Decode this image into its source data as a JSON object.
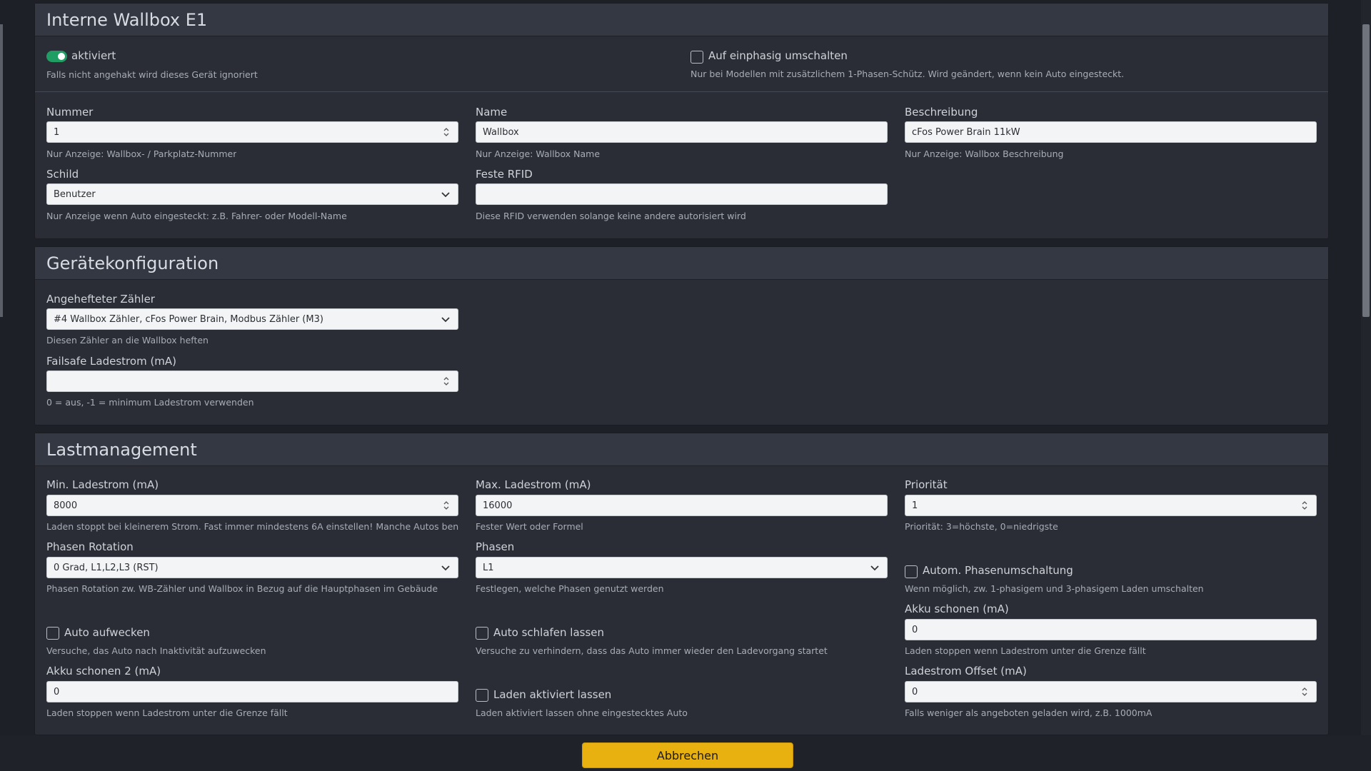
{
  "wallbox_section": {
    "title": "Interne Wallbox E1",
    "activated_label": "aktiviert",
    "activated_help": "Falls nicht angehakt wird dieses Gerät ignoriert",
    "single_phase_label": "Auf einphasig umschalten",
    "single_phase_help": "Nur bei Modellen mit zusätzlichem 1-Phasen-Schütz. Wird geändert, wenn kein Auto eingesteckt.",
    "number": {
      "label": "Nummer",
      "value": "1",
      "help": "Nur Anzeige: Wallbox- / Parkplatz-Nummer"
    },
    "name": {
      "label": "Name",
      "value": "Wallbox",
      "help": "Nur Anzeige: Wallbox Name"
    },
    "description": {
      "label": "Beschreibung",
      "value": "cFos Power Brain 11kW",
      "help": "Nur Anzeige: Wallbox Beschreibung"
    },
    "sign": {
      "label": "Schild",
      "value": "Benutzer",
      "help": "Nur Anzeige wenn Auto eingesteckt: z.B. Fahrer- oder Modell-Name"
    },
    "rfid": {
      "label": "Feste RFID",
      "value": "",
      "help": "Diese RFID verwenden solange keine andere autorisiert wird"
    }
  },
  "device_config": {
    "title": "Gerätekonfiguration",
    "meter": {
      "label": "Angehefteter Zähler",
      "value": "#4 Wallbox Zähler, cFos Power Brain, Modbus Zähler (M3)",
      "help": "Diesen Zähler an die Wallbox heften"
    },
    "failsafe": {
      "label": "Failsafe Ladestrom (mA)",
      "value": "",
      "help": "0 = aus, -1 = minimum Ladestrom verwenden"
    }
  },
  "load_management": {
    "title": "Lastmanagement",
    "min_current": {
      "label": "Min. Ladestrom (mA)",
      "value": "8000",
      "help": "Laden stoppt bei kleinerem Strom. Fast immer mindestens 6A einstellen! Manche Autos benötige..."
    },
    "max_current": {
      "label": "Max. Ladestrom (mA)",
      "value": "16000",
      "help": "Fester Wert oder Formel"
    },
    "priority": {
      "label": "Priorität",
      "value": "1",
      "help": "Priorität: 3=höchste, 0=niedrigste"
    },
    "phase_rotation": {
      "label": "Phasen Rotation",
      "value": "0 Grad, L1,L2,L3 (RST)",
      "help": "Phasen Rotation zw. WB-Zähler und Wallbox in Bezug auf die Hauptphasen im Gebäude"
    },
    "phases": {
      "label": "Phasen",
      "value": "L1",
      "help": "Festlegen, welche Phasen genutzt werden"
    },
    "auto_phase": {
      "label": "Autom. Phasenumschaltung",
      "help": "Wenn möglich, zw. 1-phasigem und 3-phasigem Laden umschalten"
    },
    "wake_car": {
      "label": "Auto aufwecken",
      "help": "Versuche, das Auto nach Inaktivität aufzuwecken"
    },
    "let_sleep": {
      "label": "Auto schlafen lassen",
      "help": "Versuche zu verhindern, dass das Auto immer wieder den Ladevorgang startet"
    },
    "battery_save": {
      "label": "Akku schonen (mA)",
      "value": "0",
      "help": "Laden stoppen wenn Ladestrom unter die Grenze fällt"
    },
    "battery_save2": {
      "label": "Akku schonen 2 (mA)",
      "value": "0",
      "help": "Laden stoppen wenn Ladestrom unter die Grenze fällt"
    },
    "keep_enabled": {
      "label": "Laden aktiviert lassen",
      "help": "Laden aktiviert lassen ohne eingestecktes Auto"
    },
    "current_offset": {
      "label": "Ladestrom Offset (mA)",
      "value": "0",
      "help": "Falls weniger als angeboten geladen wird, z.B. 1000mA"
    }
  },
  "footer": {
    "cancel_label": "Abbrechen"
  },
  "colors": {
    "accent": "#e8b10f",
    "toggle_on": "#1f9d63",
    "card_bg": "#2a2d35",
    "header_bg": "#343843",
    "page_bg": "#1d2026"
  }
}
